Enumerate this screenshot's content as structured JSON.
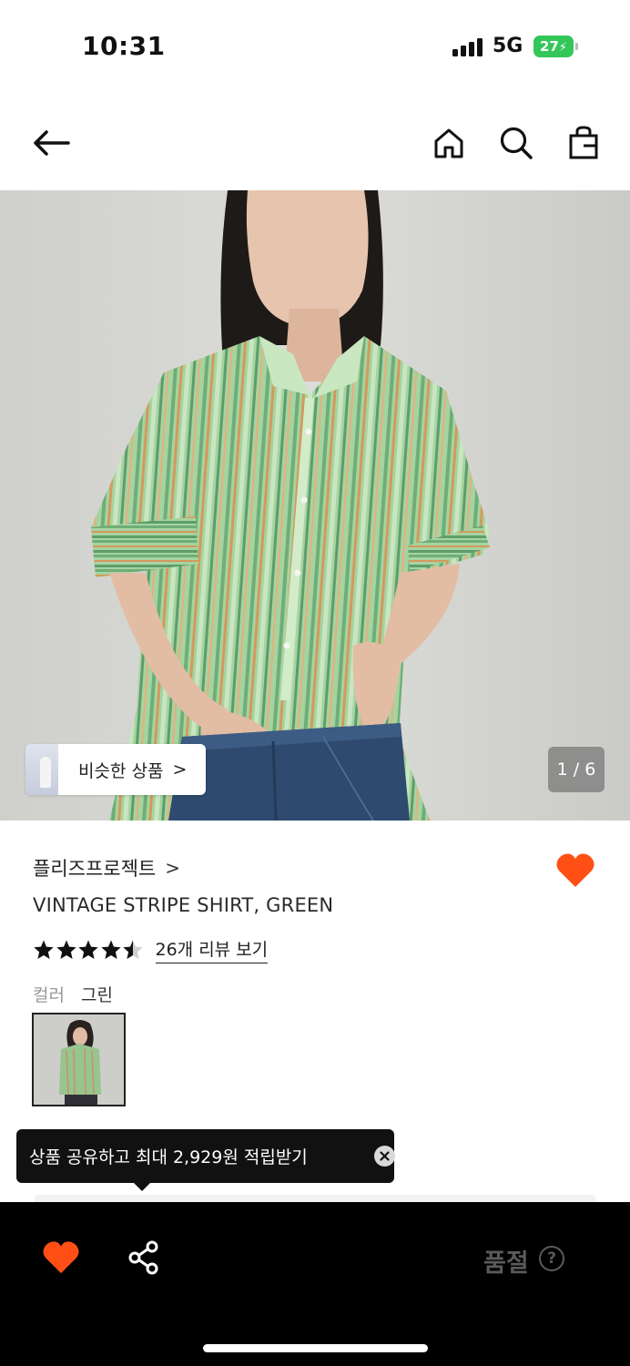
{
  "status_bar": {
    "time": "10:31",
    "network": "5G",
    "battery": "27"
  },
  "header": {
    "icons": [
      "back-arrow-icon",
      "home-icon",
      "search-icon",
      "shopping-bag-icon"
    ]
  },
  "gallery": {
    "similar_label": "비슷한 상품",
    "similar_chevron": ">",
    "page_indicator": "1 / 6"
  },
  "product": {
    "brand": "플리즈프로젝트",
    "brand_chevron": ">",
    "title": "VINTAGE STRIPE SHIRT, GREEN",
    "rating": 4.5,
    "review_link": "26개 리뷰 보기",
    "color_label": "컬러",
    "color_value": "그린",
    "wishlisted": true
  },
  "tooltip": {
    "text": "상품 공유하고 최대 2,929원 적립받기"
  },
  "bottom_bar": {
    "status": "품절",
    "help": "?"
  },
  "colors": {
    "accent": "#ff4f14",
    "bottom_bar": "#000000",
    "soldout_text": "#5a5a5a",
    "shirt_green": "#9ccc98"
  }
}
